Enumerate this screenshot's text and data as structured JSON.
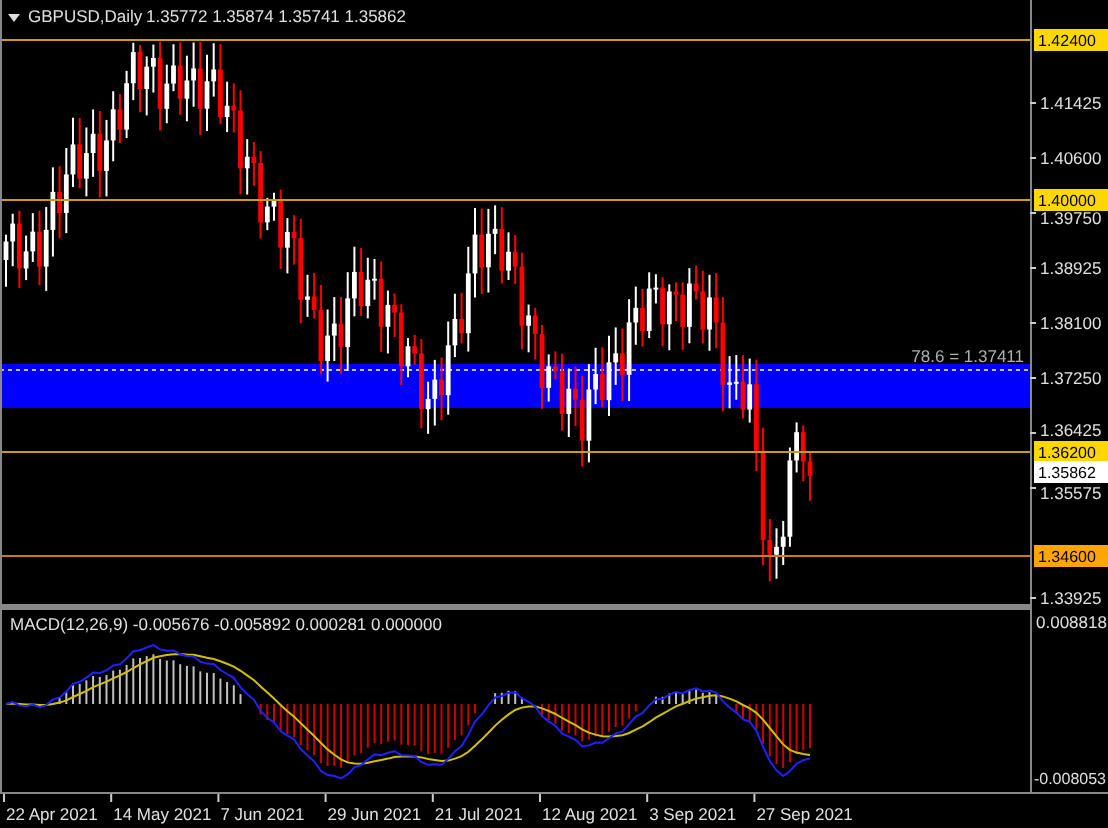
{
  "header": {
    "symbol": "GBPUSD,Daily",
    "quotes": "1.35772 1.35874 1.35741 1.35862"
  },
  "price_axis": [
    "1.41425",
    "1.40600",
    "1.39750",
    "1.38925",
    "1.38100",
    "1.37250",
    "1.36425",
    "1.35575",
    "1.33925"
  ],
  "levels": [
    {
      "label": "1.42400",
      "color": "#ffd700"
    },
    {
      "label": "1.40000",
      "color": "#ffd700"
    },
    {
      "label": "1.36200",
      "color": "#ffd700"
    },
    {
      "label": "1.34600",
      "color": "#ffa500"
    }
  ],
  "current_price": "1.35862",
  "fibo_label": "78.6 = 1.37411",
  "macd": {
    "label": "MACD(12,26,9) -0.005676 -0.005892 0.000281 0.000000",
    "axis": [
      "0.008818",
      "-0.008053"
    ]
  },
  "dates": [
    "22 Apr 2021",
    "14 May 2021",
    "7 Jun 2021",
    "29 Jun 2021",
    "21 Jul 2021",
    "12 Aug 2021",
    "3 Sep 2021",
    "27 Sep 2021"
  ]
}
